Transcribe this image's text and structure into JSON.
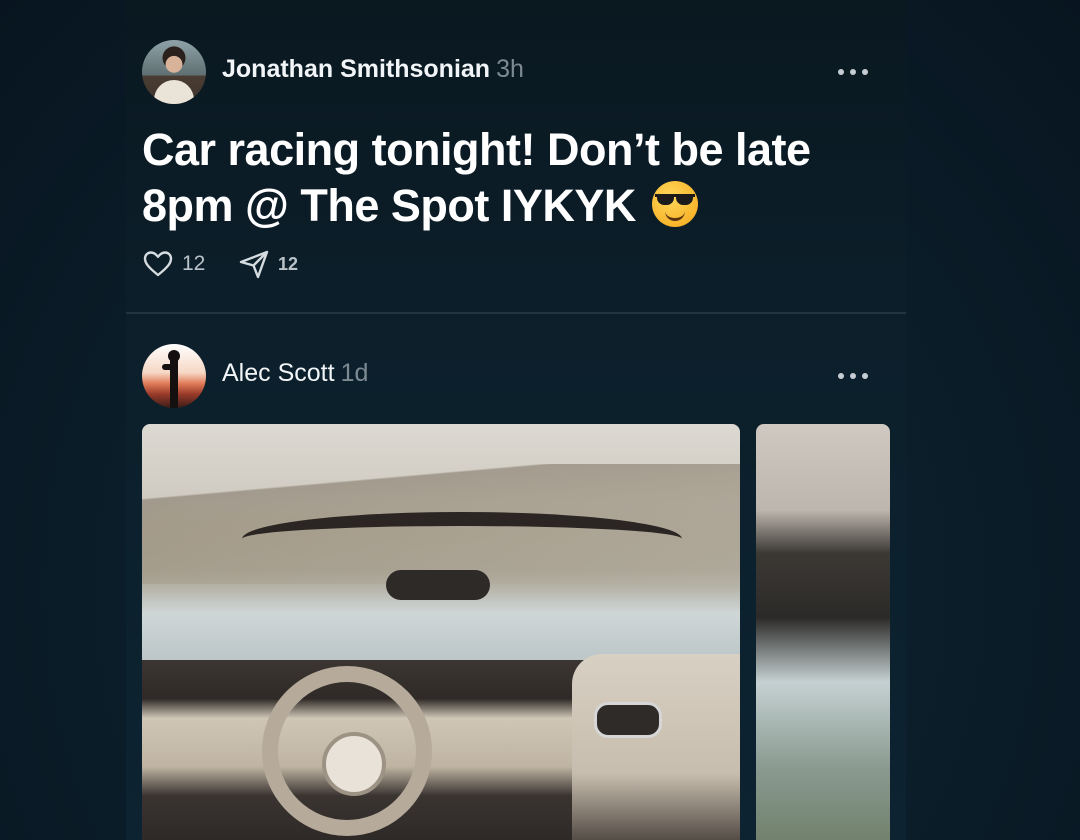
{
  "posts": [
    {
      "author": "Jonathan Smithsonian",
      "time": "3h",
      "text_line1": "Car racing tonight! Don’t be late",
      "text_line2": "8pm @ The Spot IYKYK",
      "emoji": "smiling-face-with-sunglasses",
      "likes": "12",
      "shares": "12"
    },
    {
      "author": "Alec Scott",
      "time": "1d",
      "images": [
        "convertible-car-interior-photo",
        "car-photo-partial"
      ]
    }
  ],
  "icons": {
    "like": "heart-outline-icon",
    "share": "send-paper-plane-icon",
    "more": "more-horizontal-icon"
  },
  "colors": {
    "background": "#0b1f2b",
    "text": "#ffffff",
    "muted": "#7d8a92",
    "divider": "#24343e"
  }
}
